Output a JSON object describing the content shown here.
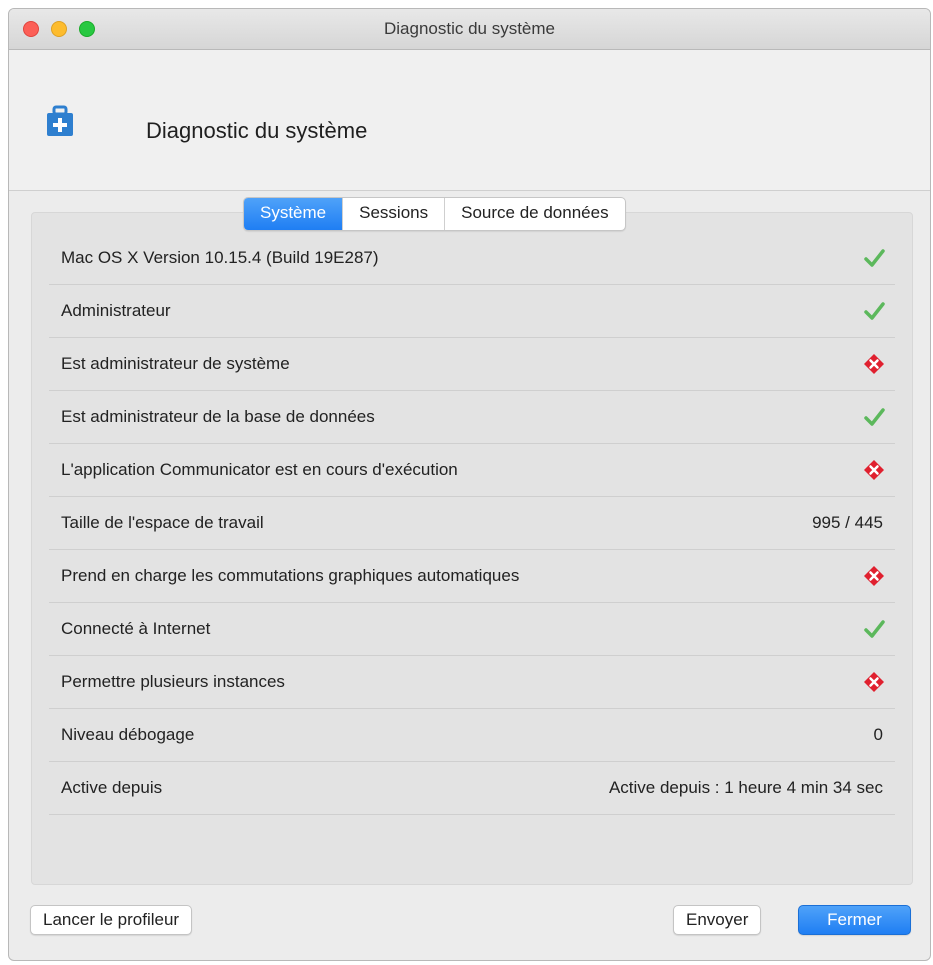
{
  "window": {
    "title": "Diagnostic du système"
  },
  "header": {
    "title": "Diagnostic du système",
    "icon": "medical-kit-icon"
  },
  "tabs": [
    {
      "label": "Système",
      "active": true
    },
    {
      "label": "Sessions",
      "active": false
    },
    {
      "label": "Source de données",
      "active": false
    }
  ],
  "colors": {
    "accent": "#2f8cf6",
    "ok": "#5cb85c",
    "error": "#e0202f"
  },
  "rows": [
    {
      "label": "Mac OS X Version 10.15.4 (Build 19E287)",
      "status": "ok"
    },
    {
      "label": "Administrateur",
      "status": "ok"
    },
    {
      "label": "Est administrateur de système",
      "status": "error"
    },
    {
      "label": "Est administrateur de la base de données",
      "status": "ok"
    },
    {
      "label": "L'application Communicator est en cours d'exécution",
      "status": "error"
    },
    {
      "label": "Taille de l'espace de travail",
      "value": "995 / 445"
    },
    {
      "label": "Prend en charge les commutations graphiques automatiques",
      "status": "error"
    },
    {
      "label": "Connecté à Internet",
      "status": "ok"
    },
    {
      "label": "Permettre plusieurs instances",
      "status": "error"
    },
    {
      "label": "Niveau débogage",
      "value": "0"
    },
    {
      "label": "Active depuis",
      "value": "Active depuis : 1 heure 4 min 34 sec"
    }
  ],
  "buttons": {
    "profiler": "Lancer le profileur",
    "send": "Envoyer",
    "close": "Fermer"
  }
}
